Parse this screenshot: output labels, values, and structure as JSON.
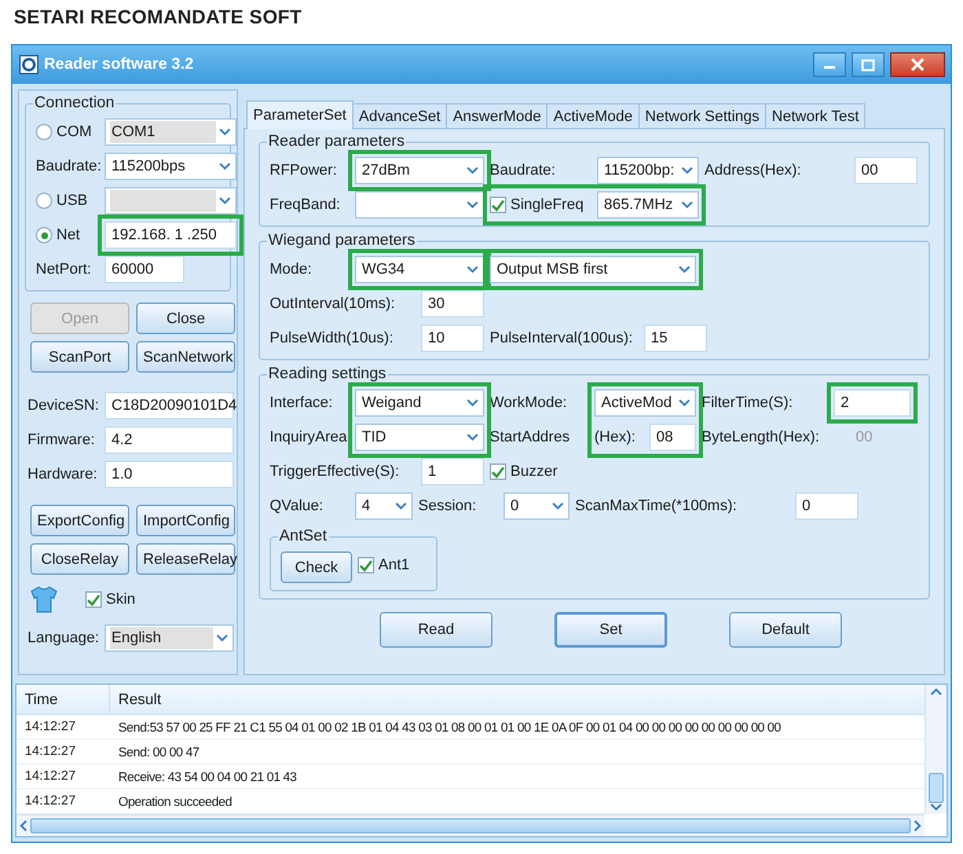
{
  "page_heading": "SETARI RECOMANDATE SOFT",
  "window": {
    "title": "Reader software 3.2"
  },
  "connection": {
    "title": "Connection",
    "lines": [
      {
        "items": [
          {
            "kind": "radio",
            "label": "COM",
            "selected": false
          },
          {
            "kind": "combo",
            "value": "COM1",
            "disabled": true
          }
        ]
      },
      {
        "items": [
          {
            "kind": "label",
            "text": "Baudrate:"
          },
          {
            "kind": "combo",
            "value": "115200bps",
            "disabled": false
          }
        ]
      },
      {
        "items": [
          {
            "kind": "radio",
            "label": "USB",
            "selected": false
          },
          {
            "kind": "combo",
            "disabled": true
          }
        ]
      },
      {
        "items": [
          {
            "kind": "radio",
            "label": "Net",
            "selected": true
          },
          {
            "kind": "highlight",
            "items": [
              {
                "kind": "field",
                "value": "192.168. 1 .250"
              }
            ]
          }
        ]
      },
      {
        "items": [
          {
            "kind": "label",
            "text": "NetPort:"
          },
          {
            "kind": "field",
            "value": "60000"
          }
        ]
      }
    ]
  },
  "connection_buttons": [
    {
      "label": "Open",
      "disabled": true
    },
    {
      "label": "Close",
      "disabled": false
    },
    {
      "label": "ScanPort",
      "disabled": false
    },
    {
      "label": "ScanNetwork",
      "disabled": false
    }
  ],
  "device_info": [
    {
      "label": "DeviceSN:",
      "value": "C18D20090101D4"
    },
    {
      "label": "Firmware:",
      "value": "4.2"
    },
    {
      "label": "Hardware:",
      "value": "1.0"
    }
  ],
  "config_buttons": [
    "ExportConfig",
    "ImportConfig",
    "CloseRelay",
    "ReleaseRelay"
  ],
  "skin": {
    "label": "Skin",
    "checked": true
  },
  "language": {
    "label": "Language:",
    "value": "English",
    "disabled": true
  },
  "tabs": [
    {
      "label": "ParameterSet",
      "selected": true
    },
    {
      "label": "AdvanceSet",
      "selected": false
    },
    {
      "label": "AnswerMode",
      "selected": false
    },
    {
      "label": "ActiveMode",
      "selected": false
    },
    {
      "label": "Network Settings",
      "selected": false
    },
    {
      "label": "Network Test",
      "selected": false
    }
  ],
  "parameter_groups": [
    {
      "title": "Reader parameters",
      "lines": [
        {
          "items": [
            {
              "kind": "label",
              "text": "RFPower:"
            },
            {
              "kind": "highlight",
              "items": [
                {
                  "kind": "combo",
                  "value": "27dBm"
                }
              ]
            },
            {
              "kind": "label",
              "text": "Baudrate:"
            },
            {
              "kind": "combo",
              "value": "115200bp:"
            },
            {
              "kind": "label",
              "text": "Address(Hex):"
            },
            {
              "kind": "field",
              "value": "00"
            }
          ]
        },
        {
          "items": [
            {
              "kind": "label",
              "text": "FreqBand:"
            },
            {
              "kind": "combo"
            },
            {
              "kind": "highlight",
              "items": [
                {
                  "kind": "check",
                  "label": "SingleFreq",
                  "checked": true
                },
                {
                  "kind": "combo",
                  "value": "865.7MHz"
                }
              ]
            }
          ]
        }
      ]
    },
    {
      "title": "Wiegand parameters",
      "lines": [
        {
          "items": [
            {
              "kind": "label",
              "text": "Mode:"
            },
            {
              "kind": "highlight",
              "items": [
                {
                  "kind": "combo",
                  "value": "WG34"
                }
              ]
            },
            {
              "kind": "highlight",
              "items": [
                {
                  "kind": "combo",
                  "value": "Output MSB first"
                }
              ]
            }
          ]
        },
        {
          "items": [
            {
              "kind": "label",
              "text": "OutInterval(10ms):"
            },
            {
              "kind": "field",
              "value": "30"
            }
          ]
        },
        {
          "items": [
            {
              "kind": "label",
              "text": "PulseWidth(10us):"
            },
            {
              "kind": "field",
              "value": "10"
            },
            {
              "kind": "label",
              "text": "PulseInterval(100us):"
            },
            {
              "kind": "field",
              "value": "15"
            }
          ]
        }
      ]
    },
    {
      "title": "Reading settings",
      "lines": [
        {
          "items": [
            {
              "kind": "stack",
              "items": [
                {
                  "kind": "label",
                  "text": "Interface:"
                },
                {
                  "kind": "label",
                  "text": "InquiryArea"
                }
              ]
            },
            {
              "kind": "highlight",
              "items": [
                {
                  "kind": "stack",
                  "items": [
                    {
                      "kind": "combo",
                      "value": "Weigand"
                    },
                    {
                      "kind": "combo",
                      "value": "TID"
                    }
                  ]
                }
              ]
            },
            {
              "kind": "stack",
              "items": [
                {
                  "kind": "label",
                  "text": "WorkMode:"
                },
                {
                  "kind": "label",
                  "text": "StartAddres"
                }
              ]
            },
            {
              "kind": "highlight",
              "items": [
                {
                  "kind": "stack",
                  "items": [
                    {
                      "kind": "combo",
                      "value": "ActiveMod"
                    },
                    {
                      "kind": "row",
                      "items": [
                        {
                          "kind": "label",
                          "text": "(Hex):"
                        },
                        {
                          "kind": "field",
                          "value": "08"
                        }
                      ]
                    }
                  ]
                }
              ]
            },
            {
              "kind": "stack",
              "items": [
                {
                  "kind": "label",
                  "text": "FilterTime(S):"
                },
                {
                  "kind": "label",
                  "text": "ByteLength(Hex):"
                }
              ]
            },
            {
              "kind": "stack",
              "items": [
                {
                  "kind": "highlight",
                  "items": [
                    {
                      "kind": "field",
                      "value": "2"
                    }
                  ]
                },
                {
                  "kind": "readonly",
                  "value": "00"
                }
              ]
            }
          ]
        },
        {
          "items": [
            {
              "kind": "label",
              "text": "TriggerEffective(S):"
            },
            {
              "kind": "field",
              "value": "1"
            },
            {
              "kind": "check",
              "label": "Buzzer",
              "checked": true
            }
          ]
        },
        {
          "items": [
            {
              "kind": "label",
              "text": "QValue:"
            },
            {
              "kind": "combo",
              "value": "4"
            },
            {
              "kind": "label",
              "text": "Session:"
            },
            {
              "kind": "combo",
              "value": "0"
            },
            {
              "kind": "label",
              "text": "ScanMaxTime(*100ms):"
            },
            {
              "kind": "field",
              "value": "0"
            }
          ]
        },
        {
          "items": [
            {
              "kind": "group",
              "title": "AntSet",
              "lines": [
                {
                  "items": [
                    {
                      "kind": "button",
                      "label": "Check"
                    },
                    {
                      "kind": "check",
                      "label": "Ant1",
                      "checked": true
                    }
                  ]
                }
              ]
            }
          ]
        }
      ]
    }
  ],
  "action_buttons": [
    "Read",
    "Set",
    "Default"
  ],
  "log": {
    "columns": [
      "Time",
      "Result"
    ],
    "rows": [
      {
        "time": "14:12:27",
        "result": "Send:53 57 00 25 FF 21 C1 55 04 01 00 02 1B 01 04 43 03 01 08 00 01 01 00 1E 0A 0F 00 01 04 00 00 00 00 00 00 00 00 00"
      },
      {
        "time": "14:12:27",
        "result": "Send: 00 00 47"
      },
      {
        "time": "14:12:27",
        "result": "Receive: 43 54 00 04 00 21 01 43"
      },
      {
        "time": "14:12:27",
        "result": "Operation succeeded"
      }
    ]
  }
}
